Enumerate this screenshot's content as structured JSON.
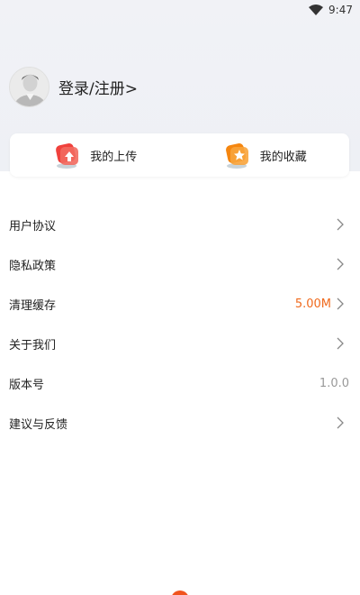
{
  "status_bar": {
    "time": "9:47",
    "icon": "wifi-icon"
  },
  "profile": {
    "avatar_icon": "avatar-placeholder",
    "login_label": "登录/注册>"
  },
  "quick_actions": [
    {
      "label": "我的上传",
      "icon": "upload-icon",
      "color": "#f0413c"
    },
    {
      "label": "我的收藏",
      "icon": "star-icon",
      "color": "#f5860f"
    }
  ],
  "menu": [
    {
      "label": "用户协议",
      "value": "",
      "chevron": true
    },
    {
      "label": "隐私政策",
      "value": "",
      "chevron": true
    },
    {
      "label": "清理缓存",
      "value": "5.00M",
      "chevron": true
    },
    {
      "label": "关于我们",
      "value": "",
      "chevron": true
    },
    {
      "label": "版本号",
      "value": "1.0.0",
      "chevron": false
    },
    {
      "label": "建议与反馈",
      "value": "",
      "chevron": true
    }
  ],
  "colors": {
    "accent": "#f06a1d",
    "header_bg": "#f1f2f6"
  }
}
